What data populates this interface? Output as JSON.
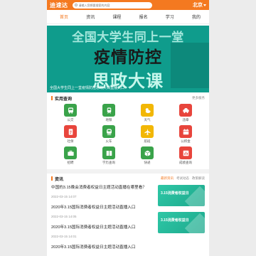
{
  "header": {
    "logo": "迪速达",
    "search_placeholder": "请输入您想要搜索的内容",
    "city": "北京"
  },
  "nav": [
    "首页",
    "资讯",
    "课程",
    "报名",
    "学习",
    "我的"
  ],
  "banner": {
    "line1": "全国大学生同上一堂",
    "line2": "疫情防控",
    "line3": "思政大课",
    "caption": "全国大学生同上一堂疫情防控思政大课直播入口"
  },
  "services": {
    "title": "实用查询",
    "more": "更多服务",
    "items": [
      {
        "label": "公交",
        "color": "#3aa34a",
        "icon": "bus-icon"
      },
      {
        "label": "地铁",
        "color": "#3aa34a",
        "icon": "metro-icon"
      },
      {
        "label": "天气",
        "color": "#f2b705",
        "icon": "weather-icon"
      },
      {
        "label": "违章",
        "color": "#e8453c",
        "icon": "car-icon"
      },
      {
        "label": "社保",
        "color": "#e8453c",
        "icon": "document-icon"
      },
      {
        "label": "火车",
        "color": "#3aa34a",
        "icon": "train-icon"
      },
      {
        "label": "航班",
        "color": "#f2b705",
        "icon": "plane-icon"
      },
      {
        "label": "公积金",
        "color": "#e8453c",
        "icon": "calendar-icon"
      },
      {
        "label": "招聘",
        "color": "#3aa34a",
        "icon": "briefcase-icon"
      },
      {
        "label": "学历查询",
        "color": "#3aa34a",
        "icon": "book-icon"
      },
      {
        "label": "快递",
        "color": "#3aa34a",
        "icon": "box-icon"
      },
      {
        "label": "成绩查询",
        "color": "#e8453c",
        "icon": "chart-icon"
      }
    ]
  },
  "news": {
    "title": "资讯",
    "tabs": [
      "最新资讯",
      "考试动态",
      "政策解读"
    ],
    "items": [
      {
        "title": "中国的3.15晚会消费者权益日主题活动直播在哪里看？",
        "date": "2022-03-15 14:07"
      },
      {
        "title": "2020年3.15国际消费者权益日主题活动直播入口",
        "date": "2022-03-15 14:05"
      },
      {
        "title": "2020年3.15国际消费者权益日主题活动直播入口",
        "date": "2022-03-15 14:01"
      },
      {
        "title": "2020年3.15国际消费者权益日主题活动直播入口",
        "date": ""
      }
    ],
    "thumbs": [
      "3.15消费者权益日",
      "3.15消费者权益日"
    ]
  }
}
